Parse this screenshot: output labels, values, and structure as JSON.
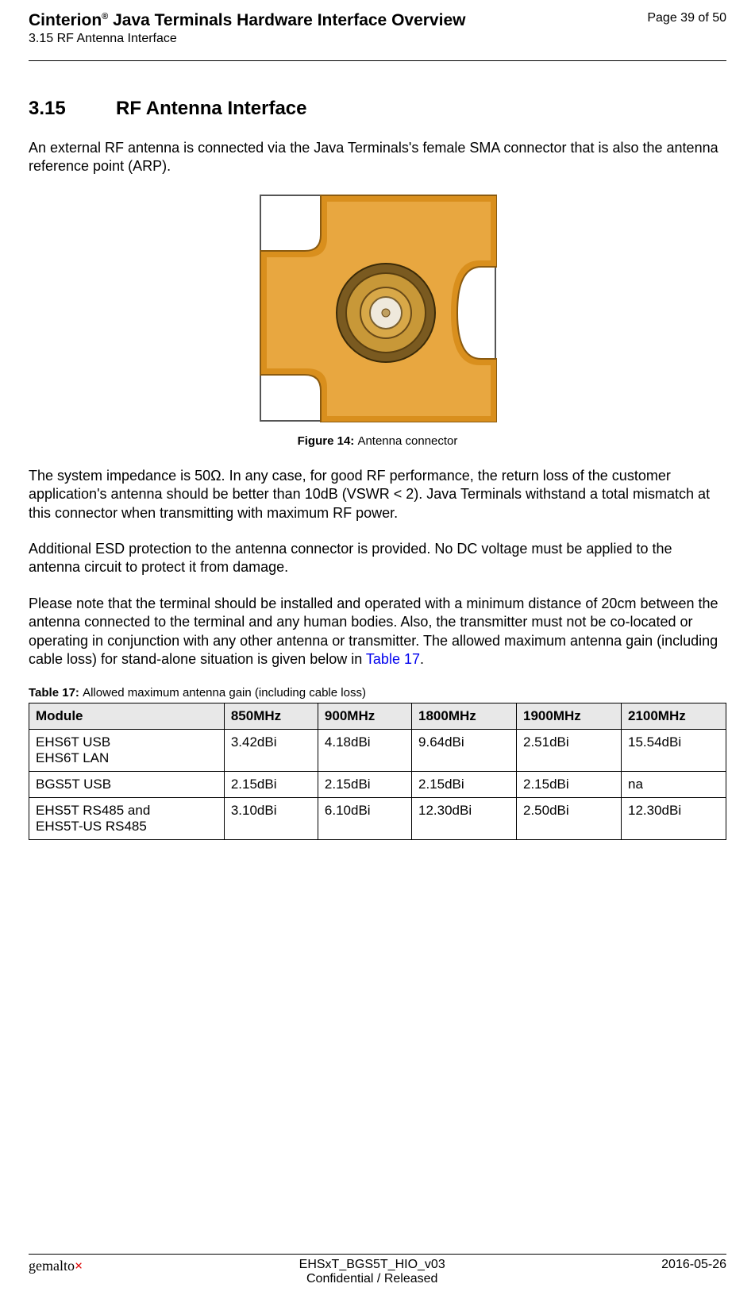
{
  "header": {
    "title_prefix": "Cinterion",
    "title_reg": "®",
    "title_rest": " Java Terminals Hardware Interface Overview",
    "subheader": "3.15 RF Antenna Interface",
    "page_marker": "Page 39 of 50"
  },
  "section": {
    "number": "3.15",
    "title": "RF Antenna Interface"
  },
  "paragraphs": {
    "p1": "An external RF antenna is connected via the Java Terminals's female SMA connector that is also the antenna reference point (ARP).",
    "p2": "The system impedance is 50Ω. In any case, for good RF performance, the return loss of the customer application's antenna should be better than 10dB (VSWR < 2). Java Terminals withstand a total mismatch at this connector when transmitting with maximum RF power.",
    "p3": "Additional ESD protection to the antenna connector is provided. No DC voltage must be applied to the antenna circuit to protect it from damage.",
    "p4a": "Please note that the terminal should be installed and operated with a minimum distance of 20cm between the antenna connected to the terminal and any human bodies. Also, the transmitter must not be co-located or operating in conjunction with any other antenna or transmitter. The allowed maximum antenna gain (including cable loss) for stand-alone situation is given below in ",
    "p4link": "Table 17",
    "p4b": "."
  },
  "figure": {
    "label": "Figure 14:",
    "caption": "Antenna connector"
  },
  "table17": {
    "label": "Table 17:",
    "caption": "Allowed maximum antenna gain (including cable loss)",
    "headers": [
      "Module",
      "850MHz",
      "900MHz",
      "1800MHz",
      "1900MHz",
      "2100MHz"
    ],
    "rows": [
      {
        "module_l1": "EHS6T USB",
        "module_l2": "EHS6T LAN",
        "c850": "3.42dBi",
        "c900": "4.18dBi",
        "c1800": "9.64dBi",
        "c1900": "2.51dBi",
        "c2100": "15.54dBi"
      },
      {
        "module_l1": "BGS5T USB",
        "module_l2": "",
        "c850": "2.15dBi",
        "c900": "2.15dBi",
        "c1800": "2.15dBi",
        "c1900": "2.15dBi",
        "c2100": "na"
      },
      {
        "module_l1": "EHS5T RS485 and",
        "module_l2": "EHS5T-US RS485",
        "c850": "3.10dBi",
        "c900": "6.10dBi",
        "c1800": "12.30dBi",
        "c1900": "2.50dBi",
        "c2100": "12.30dBi"
      }
    ]
  },
  "footer": {
    "logo_pre": "gemalto",
    "logo_sup": "×",
    "doc_version": "EHSxT_BGS5T_HIO_v03",
    "confidential": "Confidential / Released",
    "date": "2016-05-26"
  },
  "chart_data": {
    "type": "table",
    "title": "Allowed maximum antenna gain (including cable loss)",
    "columns": [
      "Module",
      "850MHz",
      "900MHz",
      "1800MHz",
      "1900MHz",
      "2100MHz"
    ],
    "rows": [
      [
        "EHS6T USB / EHS6T LAN",
        3.42,
        4.18,
        9.64,
        2.51,
        15.54
      ],
      [
        "BGS5T USB",
        2.15,
        2.15,
        2.15,
        2.15,
        null
      ],
      [
        "EHS5T RS485 and EHS5T-US RS485",
        3.1,
        6.1,
        12.3,
        2.5,
        12.3
      ]
    ],
    "unit": "dBi"
  }
}
